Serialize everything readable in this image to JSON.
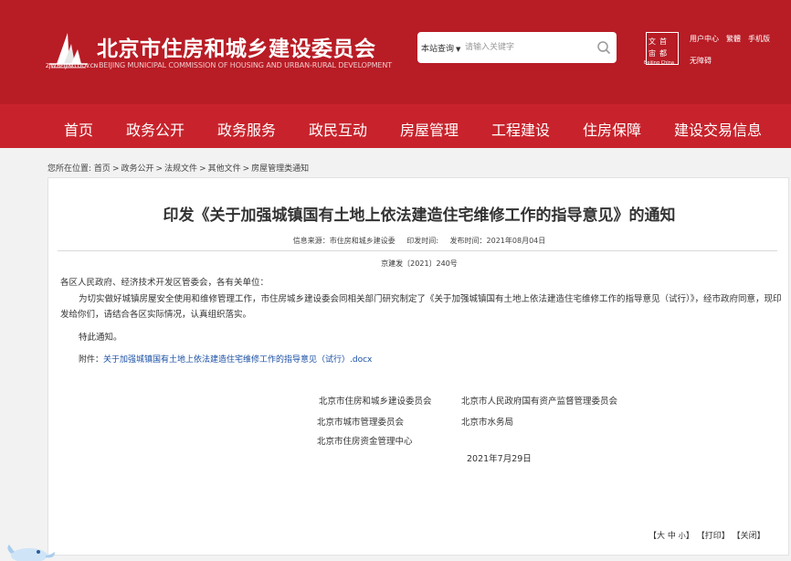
{
  "header": {
    "site_title": "北京市住房和城乡建设委员会",
    "site_subtitle": "BEIJING MUNICIPAL COMMISSION OF HOUSING AND URBAN-RURAL DEVELOPMENT",
    "logo_url_text": "ZJW.BEIJING.GOV.CN",
    "search": {
      "scope_label": "本站查询",
      "placeholder": "请输入关键字"
    },
    "capital_logo": {
      "chars": [
        "文",
        "首",
        "宙",
        "都"
      ],
      "caption": "Beijing China"
    },
    "top_links": [
      "用户中心",
      "繁體",
      "手机版"
    ],
    "accessibility_link": "无障碍"
  },
  "nav": {
    "items": [
      "首页",
      "政务公开",
      "政务服务",
      "政民互动",
      "房屋管理",
      "工程建设",
      "住房保障",
      "建设交易信息"
    ]
  },
  "breadcrumb": {
    "prefix": "您所在位置:",
    "items": [
      "首页",
      "政务公开",
      "法规文件",
      "其他文件",
      "房屋管理类通知"
    ],
    "separator": ">"
  },
  "article": {
    "title": "印发《关于加强城镇国有土地上依法建造住宅维修工作的指导意见》的通知",
    "meta": {
      "source": "信息来源：市住房和城乡建设委",
      "print_time": "印发时间:",
      "publish_time": "发布时间：2021年08月04日"
    },
    "doc_number": "京建发〔2021〕240号",
    "addressee": "各区人民政府、经济技术开发区管委会，各有关单位：",
    "para1": "为切实做好城镇房屋安全使用和维修管理工作，市住房城乡建设委会同相关部门研究制定了《关于加强城镇国有土地上依法建造住宅维修工作的指导意见（试行）》，经市政府同意，现印发给你们，请结合各区实际情况，认真组织落实。",
    "para2": "特此通知。",
    "attachment_label": "附件：",
    "attachment_link": "关于加强城镇国有土地上依法建造住宅维修工作的指导意见（试行）.docx",
    "signatories": [
      "北京市住房和城乡建设委员会",
      "北京市人民政府国有资产监督管理委员会",
      "北京市城市管理委员会",
      "北京市水务局",
      "北京市住房资金管理中心"
    ],
    "date": "2021年7月29日"
  },
  "tools": {
    "font_open": "【",
    "font_large": "大",
    "font_medium": "中",
    "font_small": "小",
    "font_close": "】",
    "print": "【打印】",
    "close": "【关闭】"
  },
  "colors": {
    "header_bg": "#b81c25",
    "nav_bg": "#c8232c",
    "link": "#1a4fa3"
  }
}
